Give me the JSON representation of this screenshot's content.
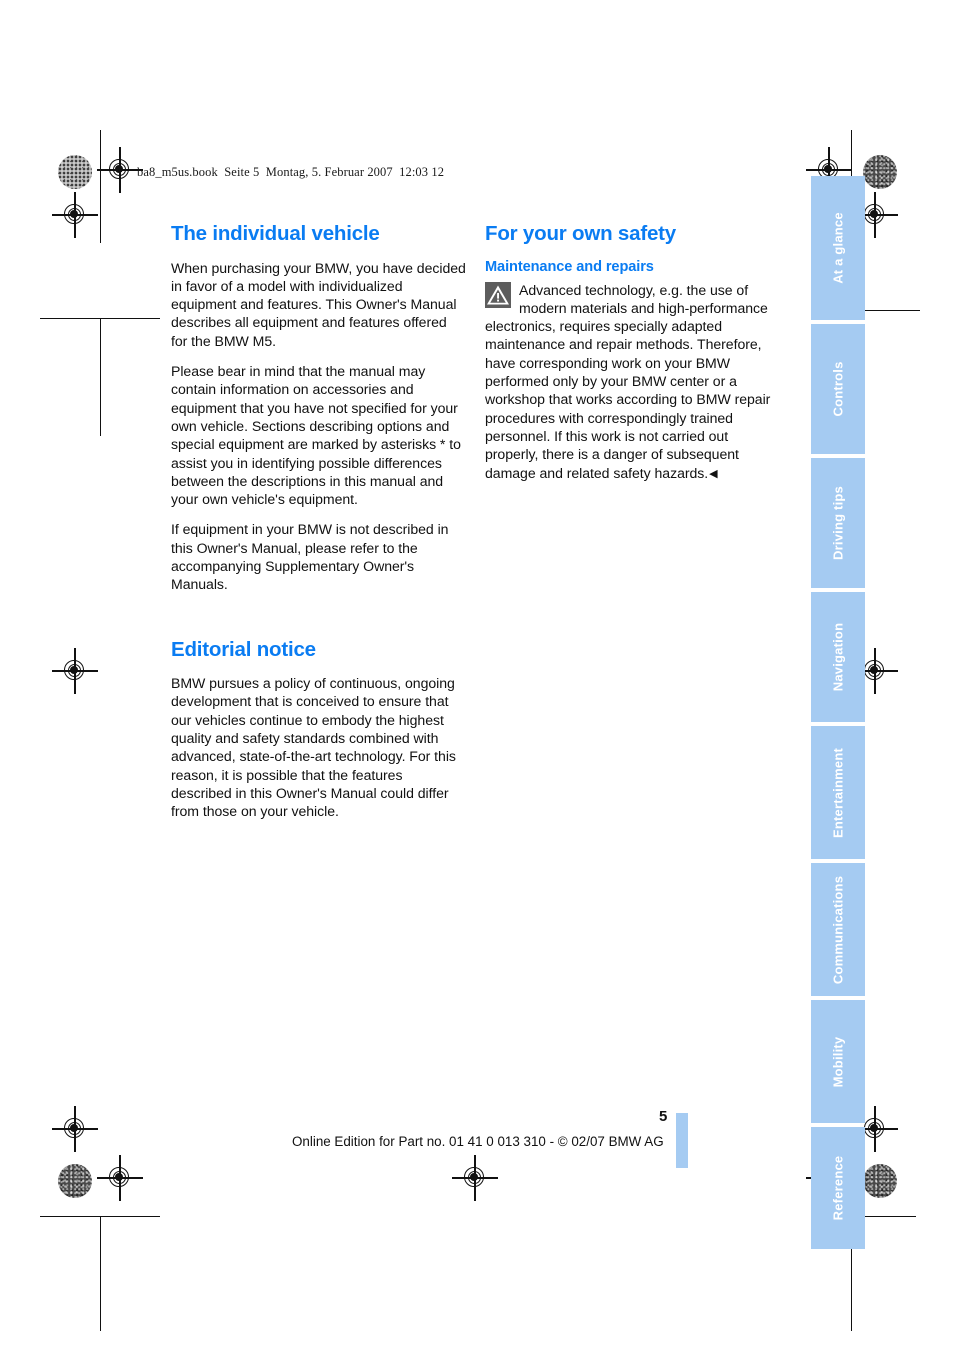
{
  "document": {
    "file_header": "ba8_m5us.book  Seite 5  Montag, 5. Februar 2007  12:03 12",
    "page_number": "5",
    "footer_note": "Online Edition for Part no. 01 41 0 013 310 - © 02/07 BMW AG"
  },
  "colors": {
    "heading_blue": "#0a7cf2",
    "tab_blue": "#a5cbf2",
    "tab_label": "#ffffff",
    "body_text": "#111111",
    "warn_icon_bg": "#5d5d5d"
  },
  "left_column": {
    "section_1": {
      "title": "The individual vehicle",
      "paragraphs": [
        "When purchasing your BMW, you have decided in favor of a model with individualized equipment and features. This Owner's Manual describes all equipment and features offered for the BMW M5.",
        "Please bear in mind that the manual may contain information on accessories and equipment that you have not specified for your own vehicle. Sections describing options and special equipment are marked by asterisks * to assist you in identifying possible differences between the descriptions in this manual and your own vehicle's equipment.",
        "If equipment in your BMW is not described in this Owner's Manual, please refer to the accompanying Supplementary Owner's Manuals."
      ]
    },
    "section_2": {
      "title": "Editorial notice",
      "paragraphs": [
        "BMW pursues a policy of continuous, ongoing development that is conceived to ensure that our vehicles continue to embody the highest quality and safety standards combined with advanced, state-of-the-art technology. For this reason, it is possible that the features described in this Owner's Manual could differ from those on your vehicle."
      ]
    }
  },
  "right_column": {
    "section_1": {
      "title": "For your own safety",
      "subtitle": "Maintenance and repairs",
      "warning_icon": "warning-triangle-icon",
      "warning_text": "Advanced technology, e.g. the use of modern materials and high-performance electronics, requires specially adapted maintenance and repair methods. Therefore, have corresponding work on your BMW performed only by your BMW center or a workshop that works according to BMW repair procedures with correspondingly trained personnel. If this work is not carried out properly, there is a danger of subsequent damage and related safety hazards.",
      "end_marker": "◀"
    }
  },
  "tabs": [
    {
      "label": "At a glance"
    },
    {
      "label": "Controls"
    },
    {
      "label": "Driving tips"
    },
    {
      "label": "Navigation"
    },
    {
      "label": "Entertainment"
    },
    {
      "label": "Communications"
    },
    {
      "label": "Mobility"
    },
    {
      "label": "Reference"
    }
  ]
}
